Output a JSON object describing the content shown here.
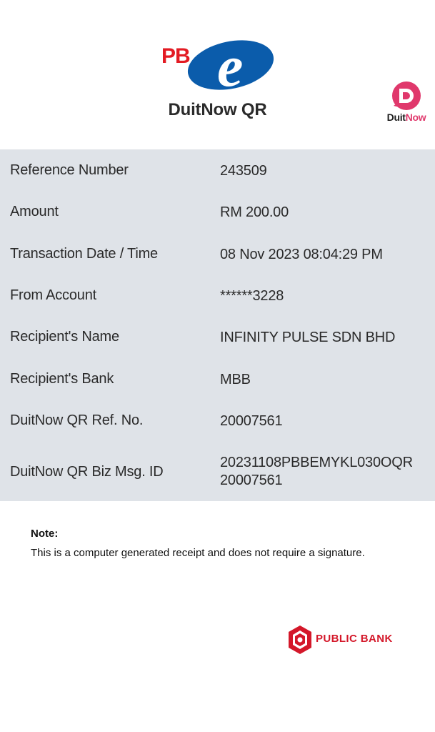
{
  "header": {
    "logo_text": "PB",
    "logo_e": "e",
    "title": "DuitNow QR",
    "badge_part1": "Duit",
    "badge_part2": "Now"
  },
  "details": [
    {
      "label": "Reference Number",
      "value": "243509"
    },
    {
      "label": "Amount",
      "value": "RM 200.00"
    },
    {
      "label": "Transaction Date / Time",
      "value": "08 Nov 2023 08:04:29 PM"
    },
    {
      "label": "From Account",
      "value": "******3228"
    },
    {
      "label": "Recipient's Name",
      "value": "INFINITY PULSE SDN BHD"
    },
    {
      "label": "Recipient's Bank",
      "value": "MBB"
    },
    {
      "label": "DuitNow QR Ref. No.",
      "value": "20007561"
    },
    {
      "label": "DuitNow QR Biz Msg. ID",
      "value": "20231108PBBEMYKL030OQR 20007561"
    }
  ],
  "note": {
    "title": "Note:",
    "text": "This is a computer generated receipt and does not require a signature."
  },
  "footer": {
    "bank_name": "PUBLIC BANK"
  },
  "colors": {
    "pb_red": "#e31b23",
    "pb_blue": "#0b5cab",
    "duitnow_pink": "#e0386c",
    "panel_bg": "#dfe3e8"
  }
}
